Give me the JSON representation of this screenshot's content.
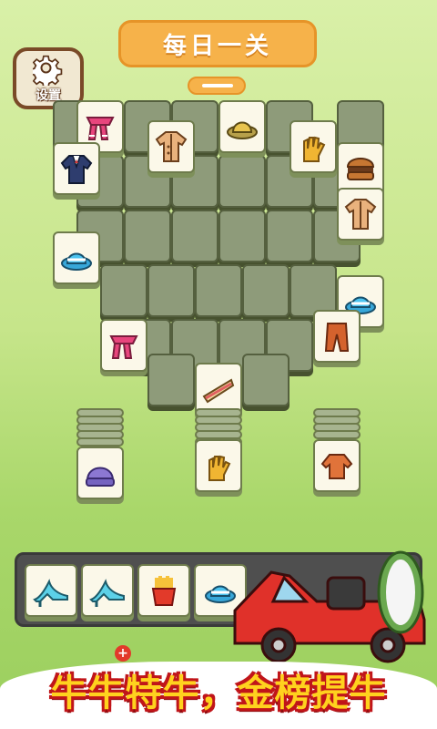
{
  "header": {
    "title": "每日一关"
  },
  "settings": {
    "label": "设置"
  },
  "board": {
    "top_tiles": [
      "scarf-icon",
      "coat-icon",
      "scarf-icon",
      "suit-icon",
      "hat-icon",
      "hat-icon",
      "coat-icon",
      "burger-icon",
      "shoe-icon",
      "sandwich-icon",
      "pants-icon",
      "scarf-icon",
      "burger-icon",
      "sweater-icon",
      "fries-icon"
    ],
    "stack_tiles": [
      "beanie-icon",
      "glove-icon",
      "sweater-icon"
    ]
  },
  "tray": {
    "items": [
      "high-heel-icon",
      "high-heel-icon",
      "fries-icon",
      "hat-icon"
    ]
  },
  "slogan": {
    "text": "牛牛特牛，金榜提牛"
  },
  "colors": {
    "accent": "#f6b24a",
    "banner_text": "#ffd21e",
    "banner_outline": "#c0151a"
  }
}
